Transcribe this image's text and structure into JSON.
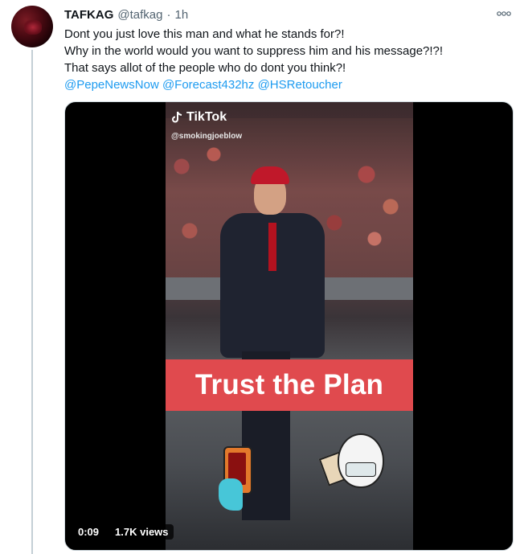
{
  "tweet": {
    "author_name": "TAFKAG",
    "author_handle": "@tafkag",
    "separator": "·",
    "time": "1h",
    "text_lines": [
      "Dont you just love this man and what he stands for?!",
      "Why in the world would you want to suppress him and his message?!?!",
      "That says allot of the people who do dont you think?!"
    ],
    "mentions": [
      "@PepeNewsNow",
      "@Forecast432hz",
      "@HSRetoucher"
    ]
  },
  "media": {
    "overlay_brand": "TikTok",
    "overlay_user": "@smokingjoeblow",
    "banner_text": "Trust the Plan",
    "duration": "0:09",
    "views": "1.7K views"
  },
  "colors": {
    "mention": "#1d9bf0",
    "banner": "#e04a4e"
  },
  "icons": {
    "more": "more-horizontal-icon",
    "tiktok": "tiktok-logo-icon"
  }
}
